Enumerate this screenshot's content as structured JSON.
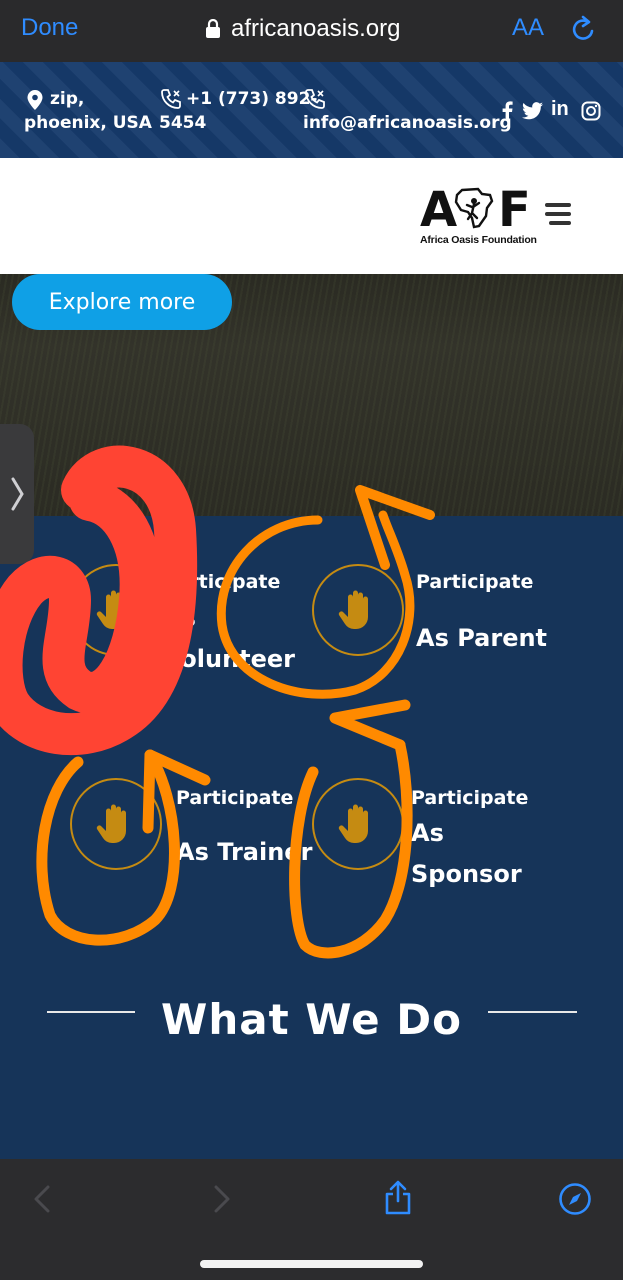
{
  "browser": {
    "done_label": "Done",
    "url": "africanoasis.org",
    "text_size_label": "AA"
  },
  "topbar": {
    "address_line1": "zip,",
    "address_line2": "phoenix, USA",
    "phone_line1": "+1 (773) 892-",
    "phone_line2": "5454",
    "email": "info@africanoasis.org",
    "socials": [
      "facebook-icon",
      "twitter-icon",
      "linkedin-icon",
      "instagram-icon"
    ]
  },
  "header": {
    "logo_letters_left": "A",
    "logo_letters_right": "F",
    "logo_tagline": "Africa Oasis Foundation"
  },
  "hero": {
    "cta_label": "Explore more"
  },
  "participate": [
    {
      "small": "Participate",
      "line1": "As",
      "line2": "Volunteer"
    },
    {
      "small": "Participate",
      "line1": "As Parent",
      "line2": ""
    },
    {
      "small": "Participate",
      "line1": "As Trainer",
      "line2": ""
    },
    {
      "small": "Participate",
      "line1": "As",
      "line2": "Sponsor"
    }
  ],
  "section": {
    "heading": "What We Do"
  },
  "colors": {
    "brand_blue": "#163459",
    "accent_gold": "#c58b12",
    "cta_blue": "#0fa0e6",
    "safari_blue": "#2f8cff",
    "annotation_orange": "#ff8a00",
    "annotation_red": "#ff4433"
  }
}
